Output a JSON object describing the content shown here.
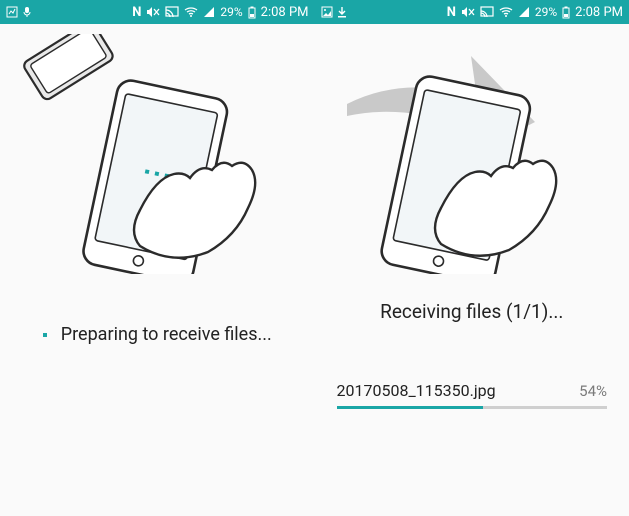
{
  "statusbar": {
    "battery_pct": "29%",
    "time": "2:08 PM",
    "icons_left_a": [
      "chart-icon",
      "mic-icon"
    ],
    "icons_left_b": [
      "image-icon",
      "download-icon"
    ],
    "icons_right": [
      "nfc-icon",
      "mute-icon",
      "cast-icon",
      "wifi-icon",
      "signal-icon"
    ]
  },
  "left": {
    "status_text": "Preparing to receive files..."
  },
  "right": {
    "header": "Receiving files (1/1)...",
    "file": {
      "name": "20170508_115350.jpg",
      "percent_label": "54%",
      "percent_value": 54
    }
  }
}
